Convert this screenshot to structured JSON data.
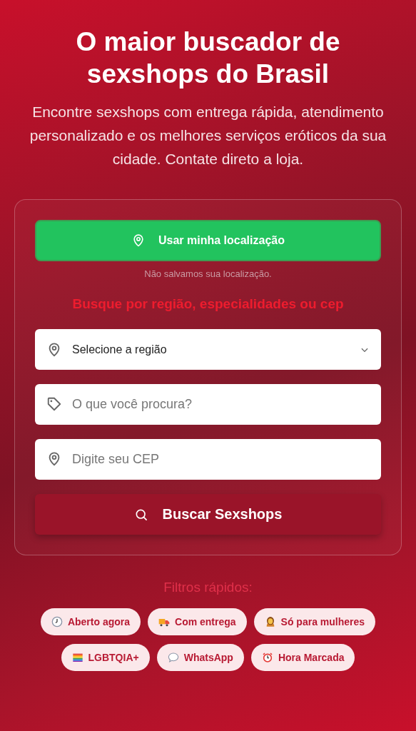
{
  "hero": {
    "title": "O maior buscador de sexshops do Brasil",
    "subtitle": "Encontre sexshops com entrega rápida, atendimento personalizado e os melhores serviços eróticos da sua cidade. Contate direto a loja."
  },
  "search_card": {
    "location_button": "Usar minha localização",
    "privacy_note": "Não salvamos sua localização.",
    "heading": "Busque por região, especialidades ou cep",
    "fields": [
      {
        "kind": "select",
        "value": "Selecione a região"
      },
      {
        "kind": "keyword",
        "placeholder": "O que você procura?"
      },
      {
        "kind": "cep",
        "placeholder": "Digite seu CEP"
      }
    ],
    "submit_button": "Buscar Sexshops"
  },
  "quick_filters": {
    "label": "Filtros rápidos:",
    "rows": [
      [
        {
          "kind": "clock",
          "label": "Aberto agora"
        },
        {
          "kind": "truck",
          "label": "Com entrega"
        },
        {
          "kind": "woman",
          "label": "Só para mulheres"
        }
      ],
      [
        {
          "kind": "flag",
          "label": "LGBTQIA+"
        },
        {
          "kind": "chat",
          "label": "WhatsApp"
        },
        {
          "kind": "alarm",
          "label": "Hora Marcada"
        }
      ]
    ]
  }
}
